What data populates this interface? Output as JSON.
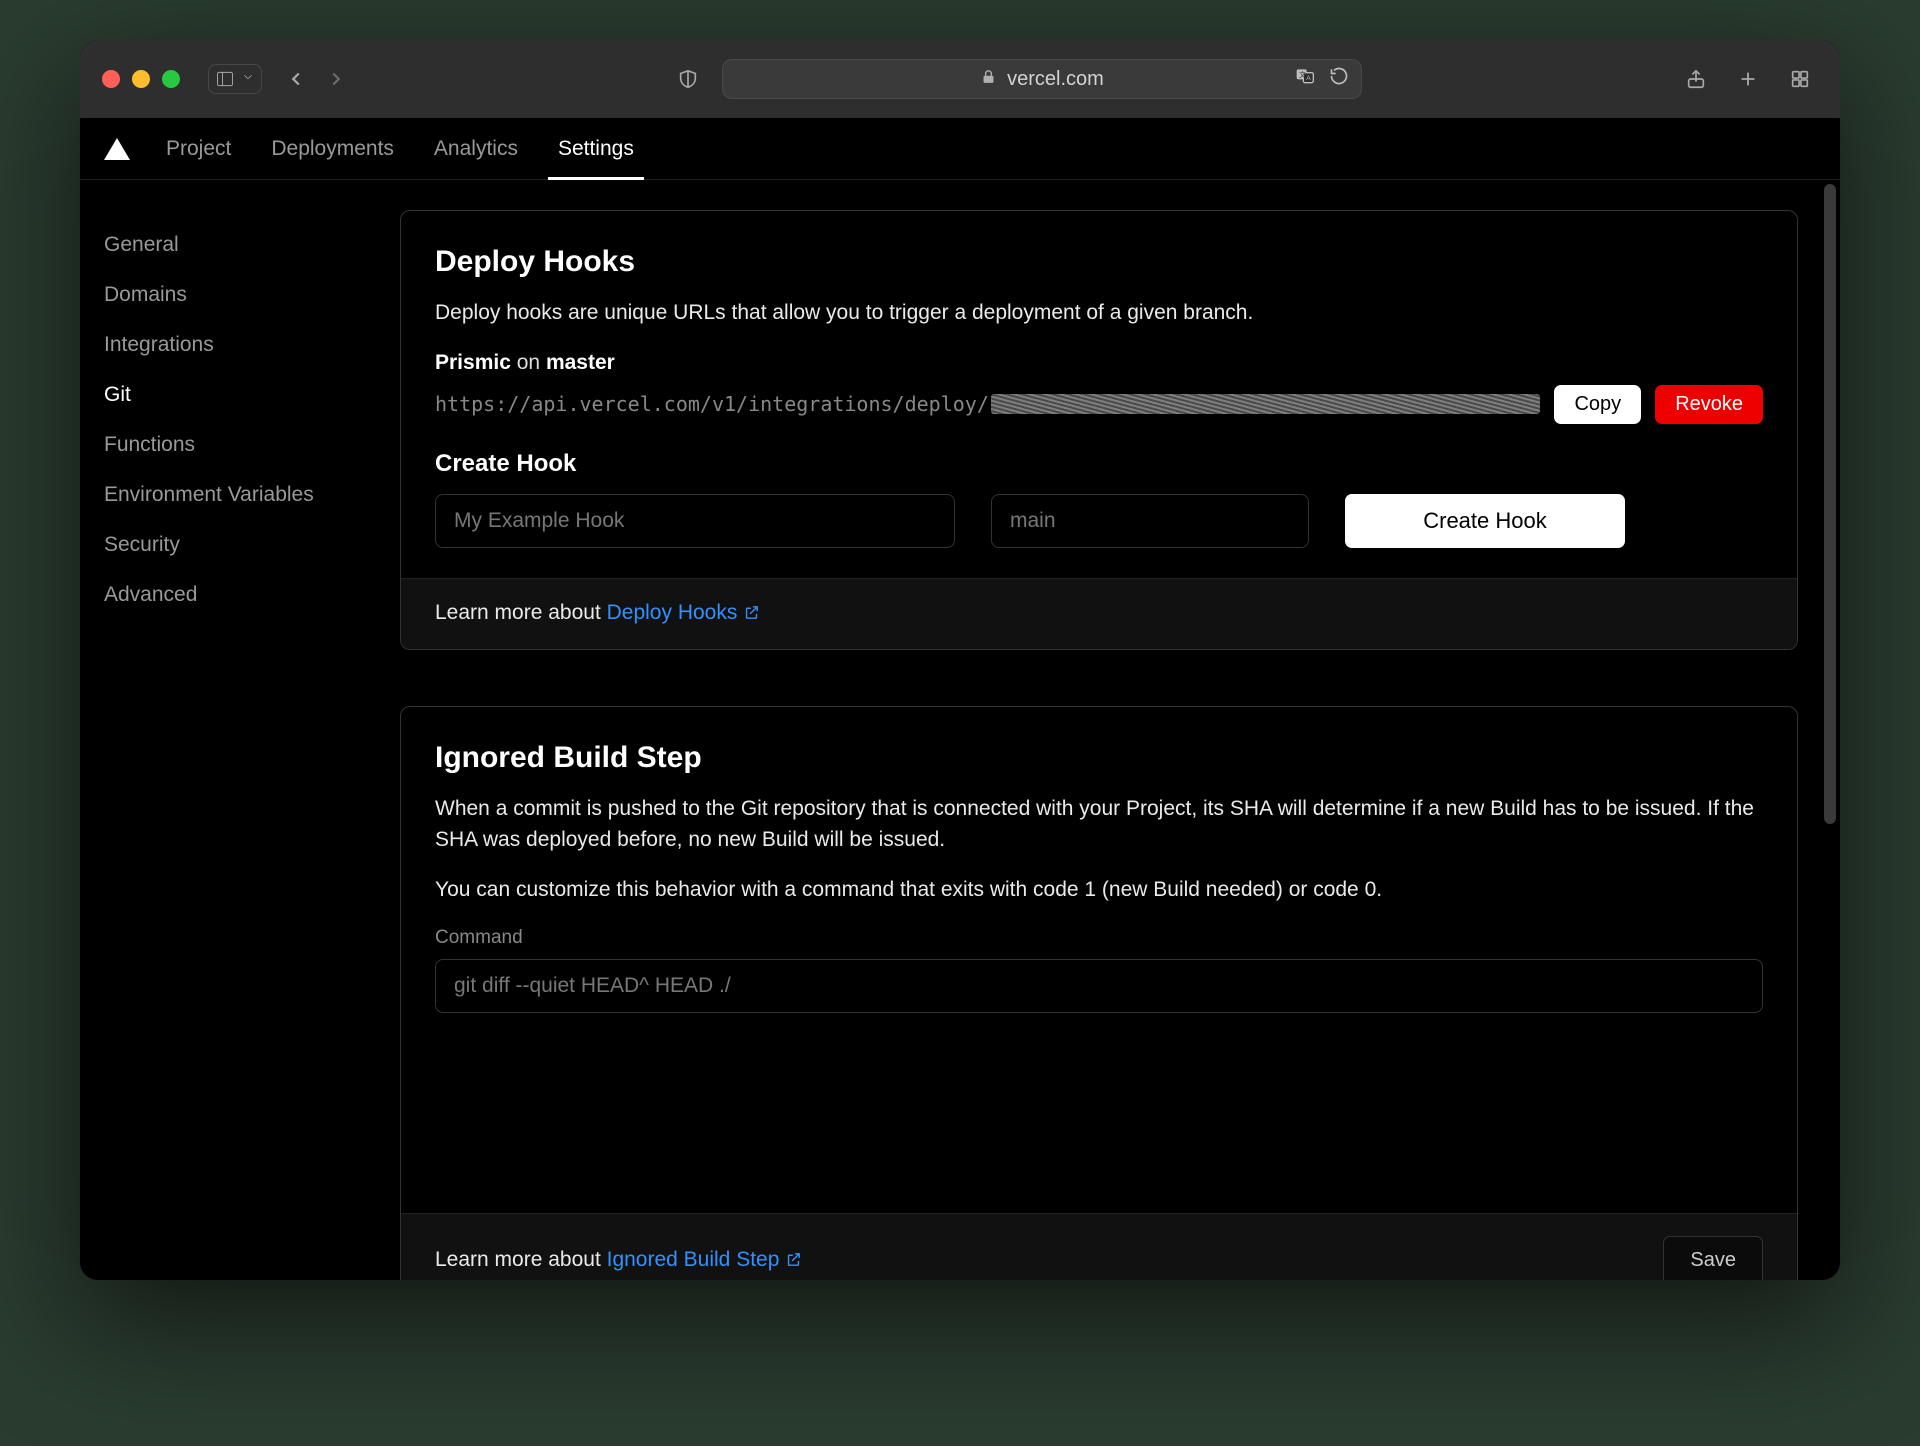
{
  "browser": {
    "url_display": "vercel.com"
  },
  "nav": {
    "items": [
      "Project",
      "Deployments",
      "Analytics",
      "Settings"
    ],
    "active_index": 3
  },
  "sidebar": {
    "items": [
      "General",
      "Domains",
      "Integrations",
      "Git",
      "Functions",
      "Environment Variables",
      "Security",
      "Advanced"
    ],
    "active_index": 3
  },
  "deploy_hooks": {
    "title": "Deploy Hooks",
    "description": "Deploy hooks are unique URLs that allow you to trigger a deployment of a given branch.",
    "hook_name": "Prismic",
    "hook_on": "on",
    "hook_branch": "master",
    "hook_url_prefix": "https://api.vercel.com/v1/integrations/deploy/",
    "copy_label": "Copy",
    "revoke_label": "Revoke",
    "create_heading": "Create Hook",
    "name_placeholder": "My Example Hook",
    "branch_placeholder": "main",
    "create_button": "Create Hook",
    "learn_prefix": "Learn more about ",
    "learn_link": "Deploy Hooks"
  },
  "ignored_build": {
    "title": "Ignored Build Step",
    "desc1": "When a commit is pushed to the Git repository that is connected with your Project, its SHA will determine if a new Build has to be issued. If the SHA was deployed before, no new Build will be issued.",
    "desc2": "You can customize this behavior with a command that exits with code 1 (new Build needed) or code 0.",
    "command_label": "Command",
    "command_placeholder": "git diff --quiet HEAD^ HEAD ./",
    "learn_prefix": "Learn more about ",
    "learn_link": "Ignored Build Step",
    "save_label": "Save"
  }
}
